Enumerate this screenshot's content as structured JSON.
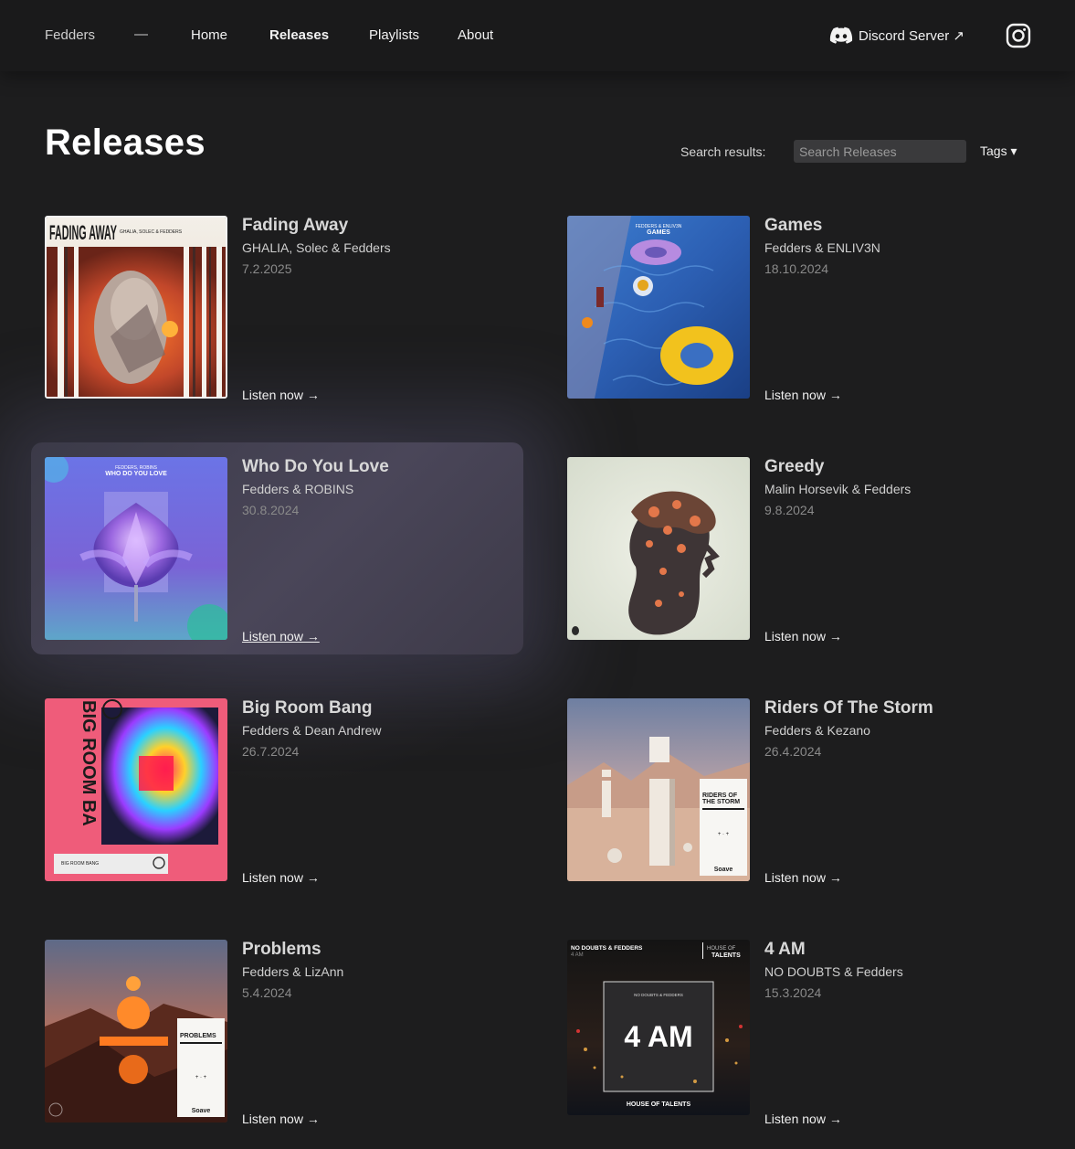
{
  "nav": {
    "brand": "Fedders",
    "dash": "—",
    "links": [
      {
        "label": "Home",
        "active": false
      },
      {
        "label": "Releases",
        "active": true
      },
      {
        "label": "Playlists",
        "active": false
      },
      {
        "label": "About",
        "active": false
      }
    ],
    "discord_label": "Discord Server ↗",
    "discord_icon": "discord-icon",
    "instagram_icon": "instagram-icon"
  },
  "header": {
    "title": "Releases",
    "search_label": "Search results:",
    "search_placeholder": "Search Releases",
    "search_value": "",
    "tags_label": "Tags ▾"
  },
  "releases": [
    {
      "title": "Fading Away",
      "artists": "GHALIA, Solec & Fedders",
      "date": "7.2.2025",
      "listen": "Listen now →",
      "cover_text": "FADING AWAY",
      "cover_subtext": "GHALIA, SOLEC & FEDDERS"
    },
    {
      "title": "Games",
      "artists": "Fedders & ENLIV3N",
      "date": "18.10.2024",
      "listen": "Listen now →",
      "cover_text": "GAMES",
      "cover_subtext": "FEDDERS & ENLIV3N"
    },
    {
      "title": "Who Do You Love",
      "artists": "Fedders & ROBINS",
      "date": "30.8.2024",
      "listen": "Listen now →",
      "cover_text": "WHO DO YOU LOVE",
      "cover_subtext": "FEDDERS, ROBINS"
    },
    {
      "title": "Greedy",
      "artists": "Malin Horsevik & Fedders",
      "date": "9.8.2024",
      "listen": "Listen now →",
      "cover_text": "",
      "cover_subtext": ""
    },
    {
      "title": "Big Room Bang",
      "artists": "Fedders & Dean Andrew",
      "date": "26.7.2024",
      "listen": "Listen now →",
      "cover_text": "BIG ROOM BA",
      "cover_subtext": "BIG ROOM BANG"
    },
    {
      "title": "Riders Of The Storm",
      "artists": "Fedders & Kezano",
      "date": "26.4.2024",
      "listen": "Listen now →",
      "cover_text": "RIDERS OF THE STORM",
      "cover_subtext": "Soave"
    },
    {
      "title": "Problems",
      "artists": "Fedders & LizAnn",
      "date": "5.4.2024",
      "listen": "Listen now →",
      "cover_text": "PROBLEMS",
      "cover_subtext": "Soave"
    },
    {
      "title": "4 AM",
      "artists": "NO DOUBTS & Fedders",
      "date": "15.3.2024",
      "listen": "Listen now →",
      "cover_text": "4 AM",
      "cover_subtext": "NO DOUBTS & FEDDERS"
    }
  ]
}
